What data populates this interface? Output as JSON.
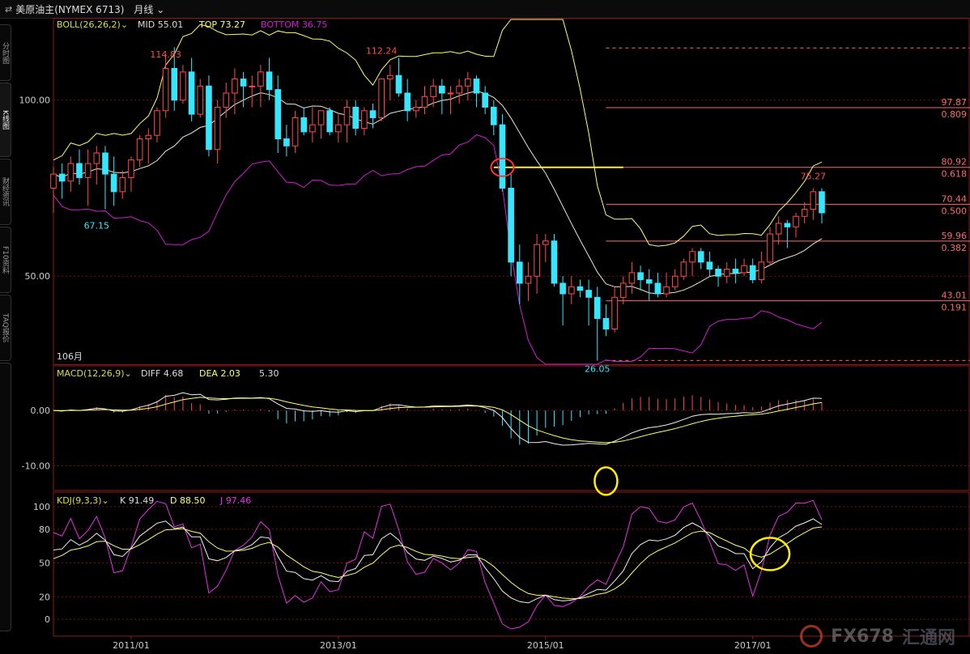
{
  "header": {
    "icon": "swap-arrows-icon",
    "symbol": "美原油主(NYMEX 6713)",
    "period": "月线",
    "period_caret": "chevron-down-icon"
  },
  "sidetabs": [
    "分时图",
    "K线图",
    "财经资讯",
    "F10资料",
    "TAQ报价"
  ],
  "legends": {
    "boll": {
      "name": "BOLL(26,26,2)",
      "mid": "MID 55.01",
      "top": "TOP 73.27",
      "bottom": "BOTTOM 36.75"
    },
    "macd": {
      "name": "MACD(12,26,9)",
      "diff": "DIFF 4.68",
      "dea": "DEA 2.03",
      "macd": "5.30"
    },
    "kdj": {
      "name": "KDJ(9,3,3)",
      "k": "K 91.49",
      "d": "D 88.50",
      "j": "J 97.46"
    },
    "bars": "106月"
  },
  "price_axis": {
    "labels": [
      {
        "v": 100,
        "t": "100.00"
      },
      {
        "v": 50,
        "t": "50.00"
      }
    ]
  },
  "macd_axis": {
    "labels": [
      {
        "v": 0,
        "t": "0.00"
      },
      {
        "v": -10,
        "t": "-10.00"
      }
    ]
  },
  "kdj_axis": {
    "labels": [
      100,
      80,
      50,
      20,
      0
    ]
  },
  "time_axis": [
    {
      "idx": 9,
      "t": "2011/01"
    },
    {
      "idx": 33,
      "t": "2013/01"
    },
    {
      "idx": 57,
      "t": "2015/01"
    },
    {
      "idx": 81,
      "t": "2017/01"
    }
  ],
  "fib_levels": [
    {
      "price": 97.87,
      "ratio": "0.809"
    },
    {
      "price": 80.92,
      "ratio": "0.618"
    },
    {
      "price": 70.44,
      "ratio": "0.500"
    },
    {
      "price": 59.96,
      "ratio": "0.382"
    },
    {
      "price": 43.01,
      "ratio": "0.191"
    }
  ],
  "annotations": {
    "high1": "114.83",
    "high2": "112.24",
    "low1": "67.15",
    "low2": "26.05",
    "last": "75.27"
  },
  "colors": {
    "up": "#ff4a4a",
    "down": "#35e6ff",
    "boll": "#ffff66",
    "mid": "#e8e8d0",
    "bottom": "#d21ad2",
    "fib": "#ff6a6a",
    "macd_dea": "#ffff66",
    "kdj_j": "#e630e6"
  },
  "watermark": {
    "logo": "coin-logo-icon",
    "brand": "FX678",
    "cn": "汇通网"
  },
  "chart_data": {
    "type": "candlestick",
    "candles": [
      [
        75,
        81,
        68,
        79
      ],
      [
        79,
        82,
        72,
        77
      ],
      [
        77,
        84,
        74,
        82
      ],
      [
        82,
        86,
        76,
        78
      ],
      [
        78,
        86,
        70,
        82
      ],
      [
        82,
        87,
        76,
        85
      ],
      [
        85,
        87,
        69,
        79
      ],
      [
        79,
        84,
        70,
        74
      ],
      [
        74,
        80,
        72,
        78
      ],
      [
        78,
        84,
        74,
        83
      ],
      [
        83,
        90,
        81,
        89
      ],
      [
        89,
        92,
        82,
        90
      ],
      [
        90,
        98,
        88,
        97
      ],
      [
        97,
        113,
        95,
        109
      ],
      [
        109,
        115,
        97,
        100
      ],
      [
        100,
        110,
        99,
        108
      ],
      [
        108,
        112,
        94,
        96
      ],
      [
        96,
        106,
        95,
        104
      ],
      [
        104,
        107,
        84,
        86
      ],
      [
        86,
        100,
        82,
        98
      ],
      [
        98,
        105,
        95,
        102
      ],
      [
        102,
        109,
        96,
        106
      ],
      [
        106,
        108,
        98,
        104
      ],
      [
        104,
        107,
        98,
        104
      ],
      [
        104,
        110,
        98,
        108
      ],
      [
        108,
        112,
        100,
        103
      ],
      [
        103,
        107,
        85,
        89
      ],
      [
        89,
        93,
        84,
        87
      ],
      [
        87,
        97,
        85,
        95
      ],
      [
        95,
        98,
        90,
        91
      ],
      [
        91,
        98,
        88,
        93
      ],
      [
        93,
        96,
        89,
        97
      ],
      [
        97,
        98,
        90,
        91
      ],
      [
        91,
        96,
        88,
        93
      ],
      [
        93,
        100,
        88,
        98
      ],
      [
        98,
        100,
        90,
        92
      ],
      [
        92,
        98,
        90,
        97
      ],
      [
        97,
        99,
        92,
        95
      ],
      [
        95,
        106,
        94,
        106
      ],
      [
        106,
        110,
        100,
        107
      ],
      [
        107,
        112,
        101,
        102
      ],
      [
        102,
        106,
        94,
        97
      ],
      [
        97,
        100,
        95,
        98
      ],
      [
        98,
        104,
        96,
        101
      ],
      [
        101,
        106,
        98,
        104
      ],
      [
        104,
        106,
        96,
        102
      ],
      [
        102,
        104,
        96,
        102
      ],
      [
        102,
        106,
        99,
        104
      ],
      [
        104,
        108,
        100,
        106
      ],
      [
        106,
        107,
        98,
        102
      ],
      [
        102,
        104,
        96,
        98
      ],
      [
        98,
        100,
        90,
        93
      ],
      [
        93,
        96,
        74,
        75
      ],
      [
        75,
        79,
        50,
        54
      ],
      [
        54,
        59,
        42,
        48
      ],
      [
        48,
        54,
        43,
        50
      ],
      [
        50,
        62,
        45,
        59
      ],
      [
        59,
        62,
        54,
        60
      ],
      [
        60,
        62,
        47,
        48
      ],
      [
        48,
        50,
        36,
        45
      ],
      [
        45,
        50,
        42,
        47
      ],
      [
        47,
        49,
        44,
        46
      ],
      [
        46,
        49,
        36,
        44
      ],
      [
        44,
        47,
        26,
        38
      ],
      [
        38,
        42,
        33,
        35
      ],
      [
        35,
        47,
        34,
        44
      ],
      [
        44,
        50,
        42,
        48
      ],
      [
        48,
        54,
        45,
        51
      ],
      [
        51,
        53,
        46,
        49
      ],
      [
        49,
        52,
        43,
        48
      ],
      [
        48,
        51,
        44,
        45
      ],
      [
        45,
        51,
        44,
        47
      ],
      [
        47,
        52,
        46,
        50
      ],
      [
        50,
        55,
        49,
        54
      ],
      [
        54,
        58,
        50,
        57
      ],
      [
        57,
        58,
        52,
        54
      ],
      [
        54,
        57,
        50,
        52
      ],
      [
        52,
        53,
        47,
        50
      ],
      [
        50,
        54,
        48,
        52
      ],
      [
        52,
        55,
        48,
        51
      ],
      [
        51,
        55,
        50,
        53
      ],
      [
        53,
        55,
        48,
        49
      ],
      [
        49,
        57,
        48,
        54
      ],
      [
        54,
        64,
        53,
        62
      ],
      [
        62,
        67,
        59,
        65
      ],
      [
        65,
        66,
        58,
        64
      ],
      [
        64,
        68,
        61,
        67
      ],
      [
        67,
        71,
        65,
        69
      ],
      [
        69,
        75,
        66,
        74
      ],
      [
        74,
        75,
        65,
        68
      ]
    ],
    "boll_top": [
      108,
      108,
      108,
      108,
      108,
      108,
      108,
      108,
      108,
      108,
      108,
      108,
      108,
      108,
      108,
      108,
      108,
      108,
      108,
      108,
      108,
      108,
      108,
      108,
      108,
      108,
      108,
      108,
      108,
      108,
      108,
      108,
      108,
      108,
      108,
      108,
      108,
      108,
      108,
      108,
      108,
      108,
      108,
      108,
      108,
      108,
      108,
      108,
      108,
      108,
      108,
      108,
      108,
      108,
      108,
      108,
      108,
      108,
      108,
      108,
      108,
      108,
      108,
      108,
      108,
      108,
      108,
      108,
      108,
      108,
      108,
      108,
      108,
      108,
      108,
      108,
      108,
      108,
      108,
      108,
      108,
      108,
      108,
      108,
      108,
      108,
      108,
      108,
      108,
      108
    ],
    "boll_mid_note": "MID 55.01",
    "price_range": [
      25,
      122
    ],
    "macd_range": [
      -14.5,
      7.5
    ],
    "kdj_range": [
      -15,
      110
    ]
  }
}
